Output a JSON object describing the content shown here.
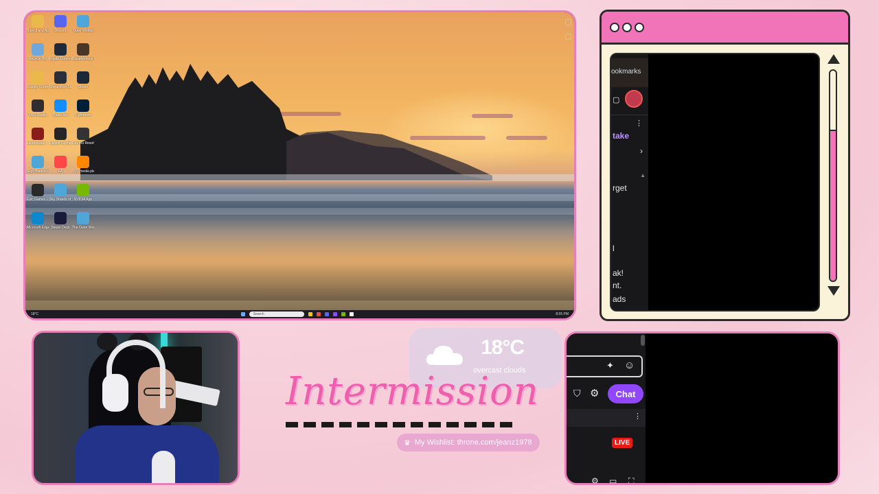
{
  "desktop": {
    "icons": [
      {
        "label": "Stencil and Apps",
        "color": "#e9b949"
      },
      {
        "label": "Discord",
        "color": "#5865f2"
      },
      {
        "label": "Outer Worlds",
        "color": "#4fa6d8"
      },
      {
        "label": "Recycle Bin",
        "color": "#6fa8dc"
      },
      {
        "label": "Elgato Camera Hub",
        "color": "#1f2b3a"
      },
      {
        "label": "Blasphemous 2",
        "color": "#4a3626"
      },
      {
        "label": "Google Chrome",
        "color": "#e9b949"
      },
      {
        "label": "StreamBee SE.Live",
        "color": "#2a2f3a"
      },
      {
        "label": "Steam",
        "color": "#1b2838"
      },
      {
        "label": "OBS Studio",
        "color": "#302e31"
      },
      {
        "label": "Battle.net",
        "color": "#148eff"
      },
      {
        "label": "Lightroom",
        "color": "#001e36"
      },
      {
        "label": "vandorbabe... Shortcut",
        "color": "#8a1c1c"
      },
      {
        "label": "Ubisoft Connect",
        "color": "#262626"
      },
      {
        "label": "DaVinci Resolve",
        "color": "#333"
      },
      {
        "label": "Skys Blades of Gmod",
        "color": "#4fa6d8"
      },
      {
        "label": "EA",
        "color": "#ff4747"
      },
      {
        "label": "VLC media player",
        "color": "#ff8800"
      },
      {
        "label": "Epic Games Launcher",
        "color": "#2a2a2a"
      },
      {
        "label": "Sky Shards of Darkness",
        "color": "#4fa6d8"
      },
      {
        "label": "NVIDIA App",
        "color": "#76b900"
      },
      {
        "label": "Microsoft Edge",
        "color": "#0c88d0"
      },
      {
        "label": "Steam Deck",
        "color": "#1a1a3a"
      },
      {
        "label": "The Outer Worlds 2",
        "color": "#4fa6d8"
      }
    ],
    "taskbar": {
      "search_placeholder": "Search",
      "temp": "18°C",
      "time": "8:05 PM"
    }
  },
  "browser": {
    "strip_texts": [
      "ookmarks",
      "take",
      "rget",
      "l",
      "ak!",
      "nt.",
      "ads"
    ]
  },
  "weather": {
    "temp": "18°C",
    "description": "overcast clouds",
    "icon": "cloud-icon"
  },
  "overlay": {
    "title": "Intermission",
    "wishlist": "My Wishlist: throne.com/jeanz1978"
  },
  "chat": {
    "chat_button": "Chat",
    "live_badge": "LIVE"
  },
  "colors": {
    "accent_pink": "#f274b8",
    "frame_pink": "#e77fb8",
    "twitch_purple": "#9147ff",
    "live_red": "#e91916"
  }
}
